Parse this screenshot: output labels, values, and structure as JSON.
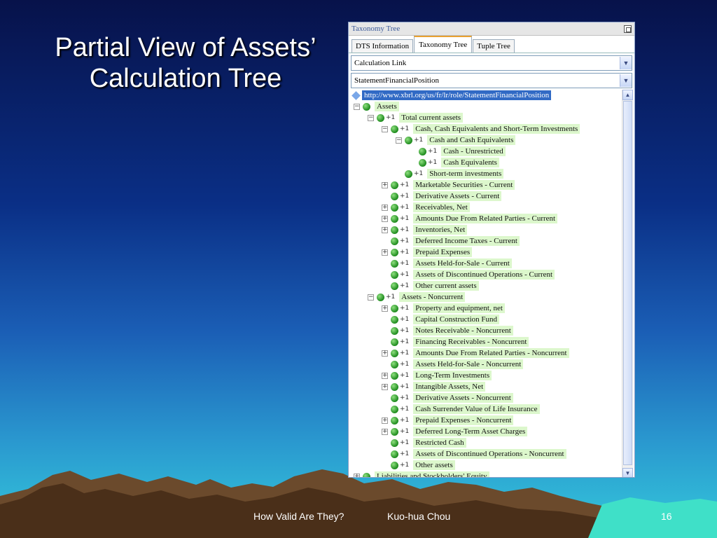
{
  "slide": {
    "title_line1": "Partial View of Assets’",
    "title_line2": "Calculation Tree",
    "footer_topic": "How Valid Are They?",
    "footer_author": "Kuo-hua Chou",
    "page_number": "16"
  },
  "window": {
    "title": "Taxonomy Tree",
    "tabs": [
      "DTS Information",
      "Taxonomy Tree",
      "Tuple Tree"
    ],
    "active_tab": "Taxonomy Tree",
    "link_select": "Calculation Link",
    "role_select": "StatementFinancialPosition",
    "root_url": "http://www.xbrl.org/us/fr/lr/role/StatementFinancialPosition",
    "weight_marker": "+1"
  },
  "tree": [
    {
      "level": 0,
      "label": "Assets",
      "expander": "minus"
    },
    {
      "level": 1,
      "label": "Total current assets",
      "expander": "minus"
    },
    {
      "level": 2,
      "label": "Cash, Cash Equivalents and Short-Term Investments",
      "expander": "minus"
    },
    {
      "level": 3,
      "label": "Cash and Cash Equivalents",
      "expander": "minus"
    },
    {
      "level": 4,
      "label": "Cash - Unrestricted",
      "expander": "none"
    },
    {
      "level": 4,
      "label": "Cash Equivalents",
      "expander": "none"
    },
    {
      "level": 3,
      "label": "Short-term investments",
      "expander": "none"
    },
    {
      "level": 2,
      "label": "Marketable Securities - Current",
      "expander": "plus"
    },
    {
      "level": 2,
      "label": "Derivative Assets - Current",
      "expander": "none"
    },
    {
      "level": 2,
      "label": "Receivables, Net",
      "expander": "plus"
    },
    {
      "level": 2,
      "label": "Amounts Due From Related Parties - Current",
      "expander": "plus"
    },
    {
      "level": 2,
      "label": "Inventories, Net",
      "expander": "plus"
    },
    {
      "level": 2,
      "label": "Deferred Income Taxes - Current",
      "expander": "none"
    },
    {
      "level": 2,
      "label": "Prepaid Expenses",
      "expander": "plus"
    },
    {
      "level": 2,
      "label": "Assets Held-for-Sale - Current",
      "expander": "none"
    },
    {
      "level": 2,
      "label": "Assets of Discontinued Operations - Current",
      "expander": "none"
    },
    {
      "level": 2,
      "label": "Other current assets",
      "expander": "none"
    },
    {
      "level": 1,
      "label": "Assets - Noncurrent",
      "expander": "minus"
    },
    {
      "level": 2,
      "label": "Property and equipment, net",
      "expander": "plus"
    },
    {
      "level": 2,
      "label": "Capital Construction Fund",
      "expander": "none"
    },
    {
      "level": 2,
      "label": "Notes Receivable - Noncurrent",
      "expander": "none"
    },
    {
      "level": 2,
      "label": "Financing Receivables - Noncurrent",
      "expander": "none"
    },
    {
      "level": 2,
      "label": "Amounts Due From Related Parties - Noncurrent",
      "expander": "plus"
    },
    {
      "level": 2,
      "label": "Assets Held-for-Sale - Noncurrent",
      "expander": "none"
    },
    {
      "level": 2,
      "label": "Long-Term Investments",
      "expander": "plus"
    },
    {
      "level": 2,
      "label": "Intangible Assets, Net",
      "expander": "plus"
    },
    {
      "level": 2,
      "label": "Derivative Assets - Noncurrent",
      "expander": "none"
    },
    {
      "level": 2,
      "label": "Cash Surrender Value of Life Insurance",
      "expander": "none"
    },
    {
      "level": 2,
      "label": "Prepaid Expenses - Noncurrent",
      "expander": "plus"
    },
    {
      "level": 2,
      "label": "Deferred Long-Term Asset Charges",
      "expander": "plus"
    },
    {
      "level": 2,
      "label": "Restricted Cash",
      "expander": "none"
    },
    {
      "level": 2,
      "label": "Assets of Discontinued Operations - Noncurrent",
      "expander": "none"
    },
    {
      "level": 2,
      "label": "Other assets",
      "expander": "none"
    },
    {
      "level": 0,
      "label": "Liabilities and Stockholders' Equity",
      "expander": "plus"
    }
  ]
}
